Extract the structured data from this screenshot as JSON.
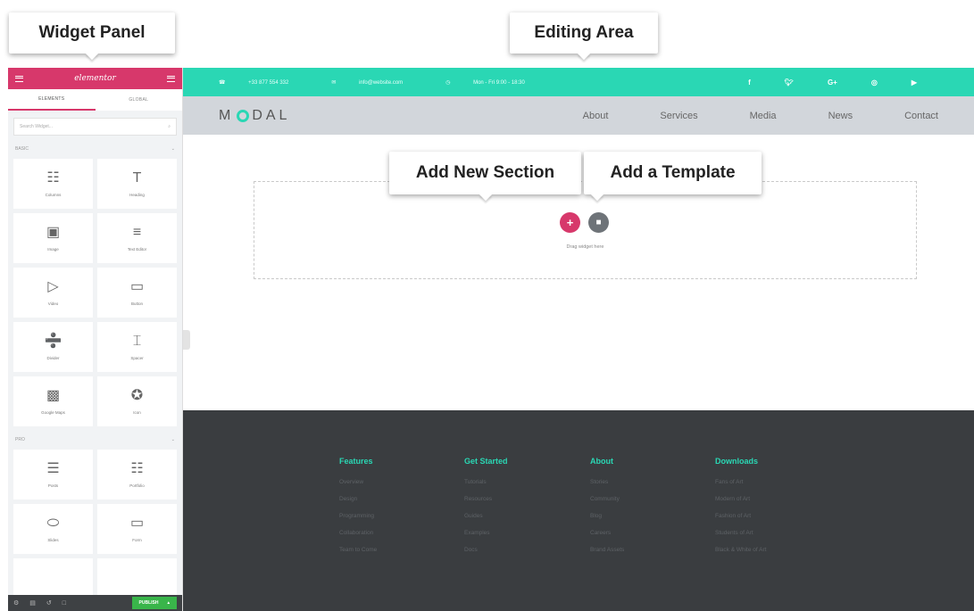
{
  "callouts": {
    "widget_panel": "Widget Panel",
    "editing_area": "Editing Area",
    "add_new_section": "Add New Section",
    "add_template": "Add a Template"
  },
  "panel": {
    "logo": "elementor",
    "tabs": [
      "ELEMENTS",
      "GLOBAL"
    ],
    "search_placeholder": "Search Widget...",
    "basic_label": "BASIC",
    "pro_label": "PRO",
    "basic_widgets": [
      {
        "label": "Columns",
        "icon": "columns-icon"
      },
      {
        "label": "Heading",
        "icon": "heading-icon"
      },
      {
        "label": "Image",
        "icon": "image-icon"
      },
      {
        "label": "Text Editor",
        "icon": "text-editor-icon"
      },
      {
        "label": "Video",
        "icon": "video-icon"
      },
      {
        "label": "Button",
        "icon": "button-icon"
      },
      {
        "label": "Divider",
        "icon": "divider-icon"
      },
      {
        "label": "Spacer",
        "icon": "spacer-icon"
      },
      {
        "label": "Google Maps",
        "icon": "map-icon"
      },
      {
        "label": "Icon",
        "icon": "star-icon"
      }
    ],
    "pro_widgets": [
      {
        "label": "Posts",
        "icon": "posts-icon"
      },
      {
        "label": "Portfolio",
        "icon": "portfolio-icon"
      },
      {
        "label": "Slides",
        "icon": "slides-icon"
      },
      {
        "label": "Form",
        "icon": "form-icon"
      }
    ],
    "publish_label": "PUBLISH"
  },
  "topbar": {
    "phone": "+33 877 554 332",
    "email": "info@website.com",
    "hours": "Mon - Fri 9:00 - 18:30",
    "social": [
      "f",
      "t",
      "G+",
      "ig",
      "yt"
    ]
  },
  "nav": {
    "brand_left": "M",
    "brand_right": "DAL",
    "items": [
      "About",
      "Services",
      "Media",
      "News",
      "Contact"
    ]
  },
  "dropzone": {
    "text": "Drag widget here"
  },
  "footer": {
    "columns": [
      {
        "heading": "Features",
        "links": [
          "Overview",
          "Design",
          "Programming",
          "Collaboration",
          "Team to Come"
        ]
      },
      {
        "heading": "Get Started",
        "links": [
          "Tutorials",
          "Resources",
          "Guides",
          "Examples",
          "Docs"
        ]
      },
      {
        "heading": "About",
        "links": [
          "Stories",
          "Community",
          "Blog",
          "Careers",
          "Brand Assets"
        ]
      },
      {
        "heading": "Downloads",
        "links": [
          "Fans of Art",
          "Modern of Art",
          "Fashion of Art",
          "Students of Art",
          "Black & White of Art"
        ]
      }
    ]
  },
  "colors": {
    "accent_teal": "#2ad7b4",
    "elementor_pink": "#d7386b",
    "footer_bg": "#3a3d40",
    "publish_green": "#39b54a"
  }
}
